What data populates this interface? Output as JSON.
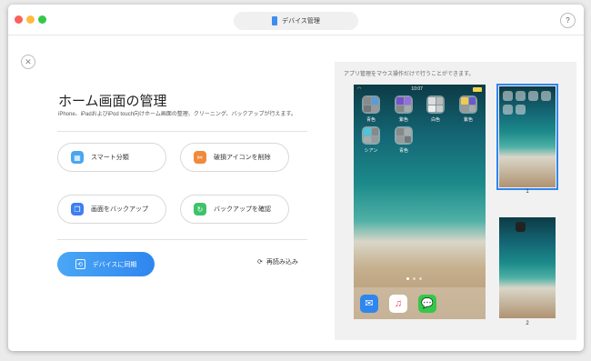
{
  "window": {
    "title": "デバイス管理",
    "help_label": "?",
    "close_label": "✕"
  },
  "page": {
    "title": "ホーム画面の管理",
    "description": "iPhone、iPadおよびiPod touch向けホーム画面の整理、クリーニング、バックアップが行えます。"
  },
  "options": [
    {
      "label": "スマート分類",
      "icon": "grid-icon",
      "color": "#4aa6f0"
    },
    {
      "label": "破損アイコンを削除",
      "icon": "broken-icon",
      "color": "#f08a3a"
    },
    {
      "label": "画面をバックアップ",
      "icon": "backup-icon",
      "color": "#3d7ff0"
    },
    {
      "label": "バックアップを確認",
      "icon": "check-icon",
      "color": "#3fc36a"
    }
  ],
  "sync_button": {
    "label": "デバイスに同期"
  },
  "reload": {
    "label": "再読み込み"
  },
  "preview": {
    "hint": "アプリ管理をマウス操作だけで行うことができます。",
    "status_time": "10:07",
    "folders": [
      {
        "label": "青色"
      },
      {
        "label": "紫色"
      },
      {
        "label": "白色"
      },
      {
        "label": "紫色"
      },
      {
        "label": "シアン"
      },
      {
        "label": "青色"
      }
    ],
    "dock": [
      "mail-icon",
      "music-icon",
      "messages-icon"
    ],
    "pages": [
      {
        "number": "1"
      },
      {
        "number": "2"
      }
    ]
  },
  "colors": {
    "accent": "#2f86ef",
    "panel_bg": "#f1f1f1"
  }
}
